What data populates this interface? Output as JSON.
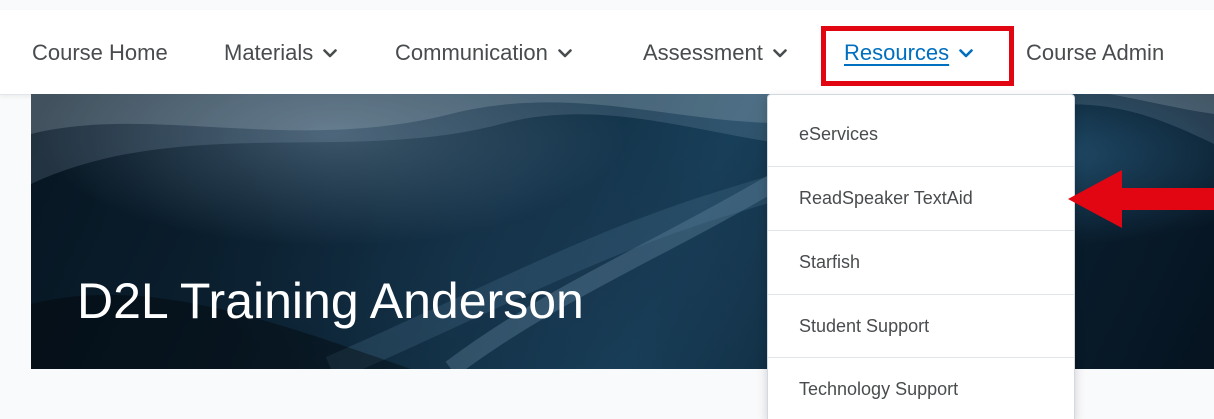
{
  "navbar": {
    "items": [
      {
        "label": "Course Home"
      },
      {
        "label": "Materials",
        "icon": "chevron-down-icon"
      },
      {
        "label": "Communication",
        "icon": "chevron-down-icon"
      },
      {
        "label": "Assessment",
        "icon": "chevron-down-icon"
      },
      {
        "label": "Resources",
        "icon": "chevron-down-icon",
        "active": true
      },
      {
        "label": "Course Admin"
      }
    ]
  },
  "banner": {
    "title": "D2L Training Anderson"
  },
  "resources_menu": {
    "items": [
      {
        "label": "eServices"
      },
      {
        "label": "ReadSpeaker TextAid"
      },
      {
        "label": "Starfish"
      },
      {
        "label": "Student Support"
      },
      {
        "label": "Technology Support"
      }
    ]
  },
  "annotations": {
    "highlight_color": "#e20613",
    "arrow_color": "#e20613",
    "arrow_icon": "left-arrow-icon"
  },
  "colors": {
    "nav_text": "#494c4e",
    "active_link": "#006fbf",
    "menu_text": "#494c4e"
  }
}
